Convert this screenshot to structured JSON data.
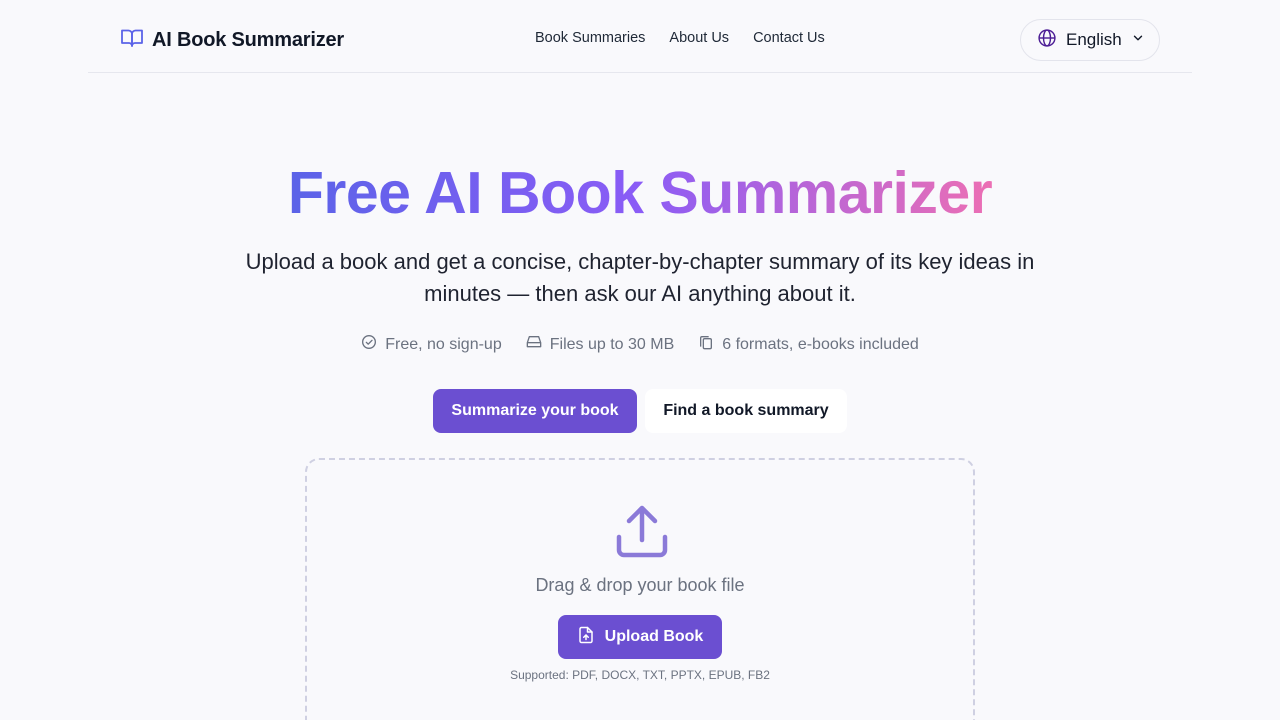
{
  "header": {
    "brand": "AI Book Summarizer",
    "nav": [
      "Book Summaries",
      "About Us",
      "Contact Us"
    ],
    "language": "English"
  },
  "hero": {
    "title": "Free AI Book Summarizer",
    "subtitle": "Upload a book and get a concise, chapter-by-chapter summary of its key ideas in minutes — then ask our AI anything about it.",
    "features": [
      "Free, no sign-up",
      "Files up to 30 MB",
      "6 formats, e-books included"
    ]
  },
  "actions": {
    "summarize_label": "Summarize your book",
    "find_label": "Find a book summary"
  },
  "upload": {
    "drop_text": "Drag & drop your book file",
    "button_label": "Upload Book",
    "supported": "Supported: PDF, DOCX, TXT, PPTX, EPUB, FB2"
  },
  "colors": {
    "accent": "#6b4fd1",
    "gradient_start": "#5b63e8",
    "gradient_end": "#ec6fb4"
  }
}
